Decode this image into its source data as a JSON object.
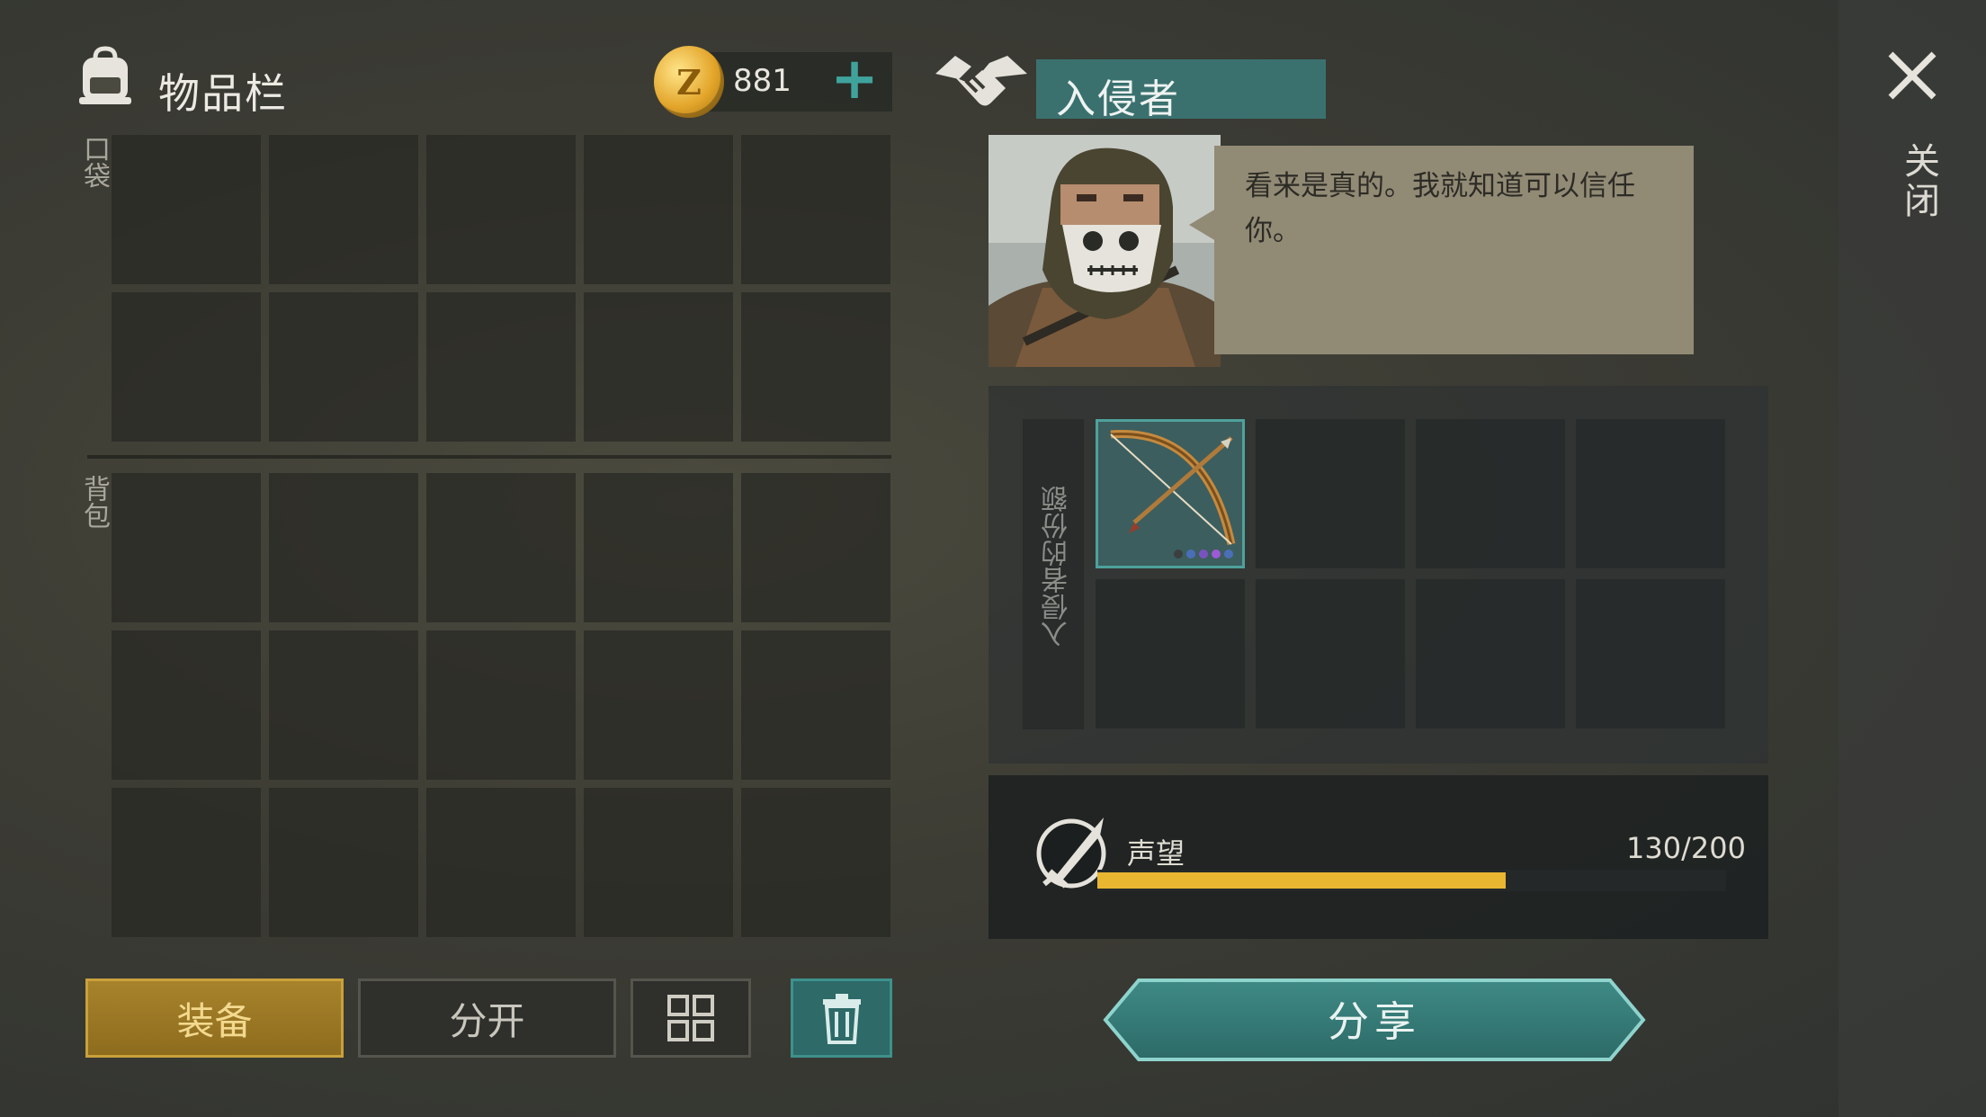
{
  "inventory": {
    "title": "物品栏",
    "pocket_label": "口袋",
    "backpack_label": "背包",
    "pocket_slots": 10,
    "backpack_slots": 15
  },
  "currency": {
    "icon": "coin-icon",
    "coin_letter": "Z",
    "amount": "881",
    "add_symbol": "+"
  },
  "buttons": {
    "equip": "装备",
    "split": "分开",
    "sort_icon": "sort-grid-icon",
    "trash_icon": "trash-icon"
  },
  "trader": {
    "name": "入侵者",
    "dialogue": "看来是真的。我就知道可以信任你。",
    "offer_label": "入侵者的份额",
    "offer_slots": 8,
    "offer_items": [
      {
        "slot": 0,
        "name": "bow-icon",
        "rarity_dots": [
          "#3b3f3f",
          "#4a6fb8",
          "#7a52c0",
          "#9b5ad6",
          "#4a6fb8"
        ]
      }
    ]
  },
  "reputation": {
    "label": "声望",
    "value_text": "130/200",
    "current": 130,
    "max": 200
  },
  "share_button": "分享",
  "close": {
    "label": "关闭",
    "icon": "close-icon"
  },
  "colors": {
    "accent_teal": "#3a716f",
    "gold": "#e9b632",
    "equip_gold": "#a7832b"
  }
}
